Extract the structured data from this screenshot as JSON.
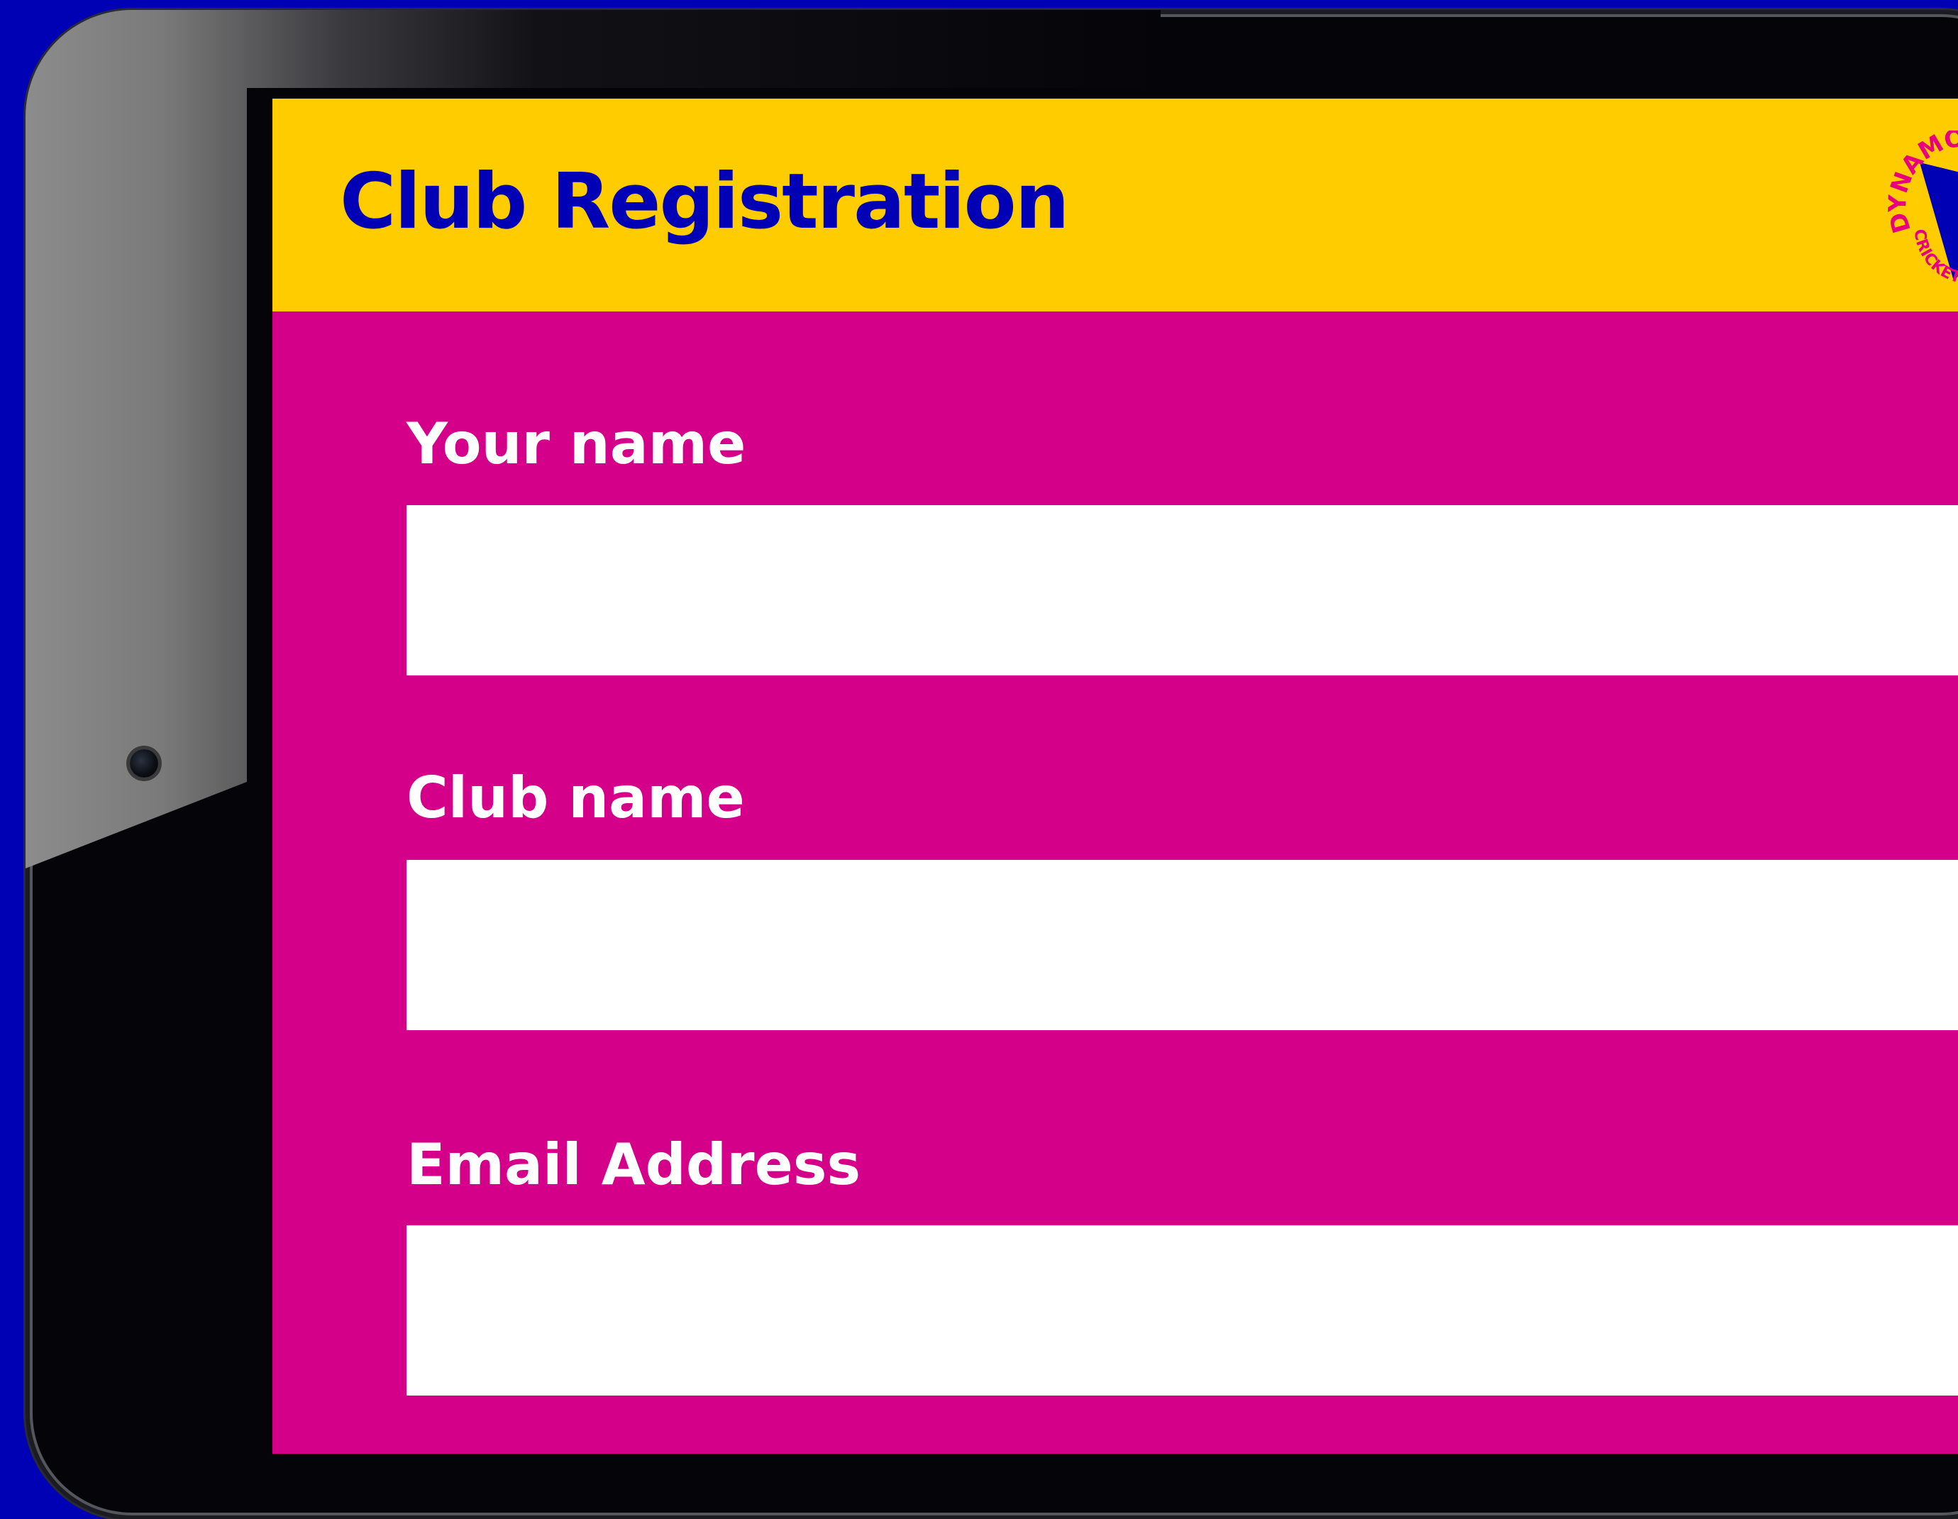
{
  "app": {
    "title": "Club Registration",
    "logo": {
      "icon": "club-logo",
      "text_top": "DYNAMOS",
      "text_bottom": "CRICKET"
    }
  },
  "form": {
    "fields": [
      {
        "label": "Your name",
        "value": "",
        "placeholder": ""
      },
      {
        "label": "Club name",
        "value": "",
        "placeholder": ""
      },
      {
        "label": "Email Address",
        "value": "",
        "placeholder": ""
      }
    ]
  },
  "colors": {
    "background": "#0000b4",
    "header": "#ffcc00",
    "brand_blue": "#0000b4",
    "form_bg": "#d4008a",
    "input_bg": "#ffffff",
    "label_text": "#ffffff"
  }
}
